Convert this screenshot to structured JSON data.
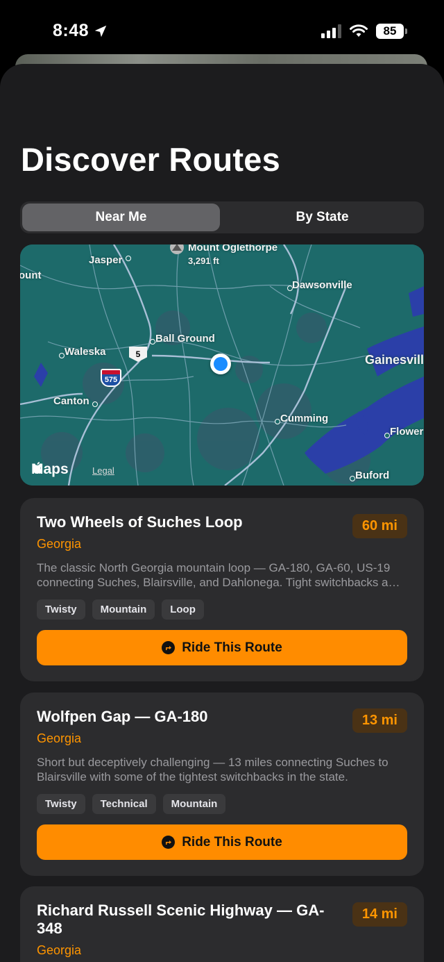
{
  "status_bar": {
    "time": "8:48",
    "battery": "85"
  },
  "title": "Discover Routes",
  "segments": [
    {
      "label": "Near Me",
      "selected": true
    },
    {
      "label": "By State",
      "selected": false
    }
  ],
  "map": {
    "peak_name": "Mount Oglethorpe",
    "peak_elevation": "3,291 ft",
    "places": {
      "jasper": "Jasper",
      "mount": "ount",
      "dawsonville": "Dawsonville",
      "ball_ground": "Ball Ground",
      "waleska": "Waleska",
      "gainesville": "Gainesvill",
      "canton": "Canton",
      "cumming": "Cumming",
      "flowery": "Flower",
      "buford": "Buford"
    },
    "highway_shield": "5",
    "interstate_shield": "575",
    "attribution": "Maps",
    "legal": "Legal"
  },
  "routes": [
    {
      "name": "Two Wheels of Suches Loop",
      "state": "Georgia",
      "distance": "60 mi",
      "description": "The classic North Georgia mountain loop — GA-180, GA-60, US-19 connecting Suches, Blairsville, and Dahlonega. Tight switchbacks and mountain views the whole way.",
      "tags": [
        "Twisty",
        "Mountain",
        "Loop"
      ],
      "action": "Ride This Route"
    },
    {
      "name": "Wolfpen Gap — GA-180",
      "state": "Georgia",
      "distance": "13 mi",
      "description": "Short but deceptively challenging — 13 miles connecting Suches to Blairsville with some of the tightest switchbacks in the state.",
      "tags": [
        "Twisty",
        "Technical",
        "Mountain"
      ],
      "action": "Ride This Route"
    },
    {
      "name": "Richard Russell Scenic Highway — GA-348",
      "state": "Georgia",
      "distance": "14 mi"
    }
  ],
  "colors": {
    "accent": "#ff8c00",
    "sheet": "#1c1c1e",
    "card": "#2c2c2e",
    "map_water": "#2b3fa8",
    "map_land": "#1d6a6a"
  }
}
